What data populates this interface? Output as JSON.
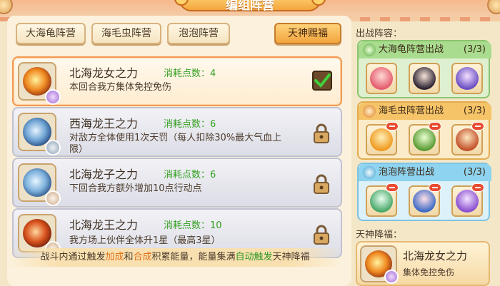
{
  "header": {
    "title": "编组阵营"
  },
  "tabs": [
    {
      "label": "大海龟阵营"
    },
    {
      "label": "海毛虫阵营"
    },
    {
      "label": "泡泡阵营"
    },
    {
      "label": "天神赐福"
    }
  ],
  "skills": [
    {
      "name": "北海龙女之力",
      "cost_label": "消耗点数：4",
      "desc": "本回合我方集体免控免伤",
      "state": "selected"
    },
    {
      "name": "西海龙王之力",
      "cost_label": "消耗点数：6",
      "desc": "对敌方全体使用1次天罚（每人扣除30%最大气血上限）",
      "state": "locked"
    },
    {
      "name": "北海龙子之力",
      "cost_label": "消耗点数：6",
      "desc": "下回合我方额外增加10点行动点",
      "state": "locked"
    },
    {
      "name": "北海龙王之力",
      "cost_label": "消耗点数：10",
      "desc": "我方场上伙伴全体升1星（最高3星）",
      "state": "locked"
    }
  ],
  "footer": {
    "p1": "战斗内通过触发",
    "h1": "加成",
    "p2": "和",
    "h2": "合成",
    "p3": "积累能量，能量集满",
    "h3": "自动触发",
    "p4": "天神降福"
  },
  "side": {
    "lineup_title": "出战阵容：",
    "camps": [
      {
        "label": "大海龟阵营出战",
        "count": "(3/3)",
        "color": "#9fd58a"
      },
      {
        "label": "海毛虫阵营出战",
        "count": "(3/3)",
        "color": "#f6c468"
      },
      {
        "label": "泡泡阵营出战",
        "count": "(3/3)",
        "color": "#8ed3ef"
      }
    ],
    "blessing_title": "天神降福：",
    "blessing": {
      "name": "北海龙女之力",
      "desc": "集体免控免伤"
    }
  },
  "colors": {
    "accent": "#f2a53e",
    "cost": "#33a022",
    "highlight": "#e0731c"
  }
}
